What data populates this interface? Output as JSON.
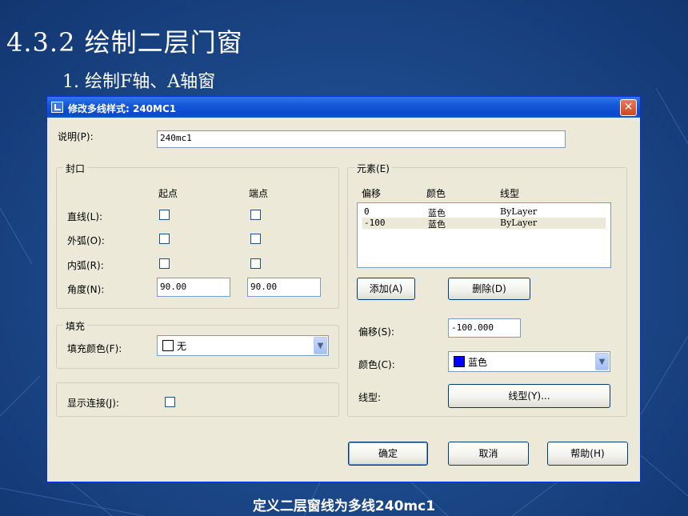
{
  "slide": {
    "title": "4.3.2 绘制二层门窗",
    "subtitle": "1. 绘制F轴、A轴窗",
    "caption": "定义二层窗线为多线240mc1"
  },
  "dialog": {
    "title": "修改多线样式:  240MC1",
    "close_glyph": "✕",
    "description_label": "说明(P):",
    "description_value": "240mc1",
    "caps": {
      "group_label": "封口",
      "start_header": "起点",
      "end_header": "端点",
      "line_label": "直线(L):",
      "outer_arc_label": "外弧(O):",
      "inner_arc_label": "内弧(R):",
      "angle_label": "角度(N):",
      "start_angle": "90.00",
      "end_angle": "90.00",
      "line_start": false,
      "line_end": false,
      "outer_start": false,
      "outer_end": false,
      "inner_start": false,
      "inner_end": false
    },
    "fill": {
      "group_label": "填充",
      "color_label": "填充颜色(F):",
      "color_value": "无",
      "swatch_color": "#ffffff"
    },
    "joints": {
      "label": "显示连接(J):",
      "checked": false
    },
    "elements": {
      "group_label": "元素(E)",
      "col_offset": "偏移",
      "col_color": "颜色",
      "col_linetype": "线型",
      "rows": [
        {
          "offset": "0",
          "color": "蓝色",
          "linetype": "ByLayer",
          "selected": false
        },
        {
          "offset": "-100",
          "color": "蓝色",
          "linetype": "ByLayer",
          "selected": true
        }
      ],
      "add_button": "添加(A)",
      "delete_button": "删除(D)",
      "offset_label": "偏移(S):",
      "offset_value": "-100.000",
      "color_label": "颜色(C):",
      "color_value": "蓝色",
      "color_swatch": "#0000ff",
      "linetype_label": "线型:",
      "linetype_button": "线型(Y)..."
    },
    "buttons": {
      "ok": "确定",
      "cancel": "取消",
      "help": "帮助(H)"
    }
  }
}
